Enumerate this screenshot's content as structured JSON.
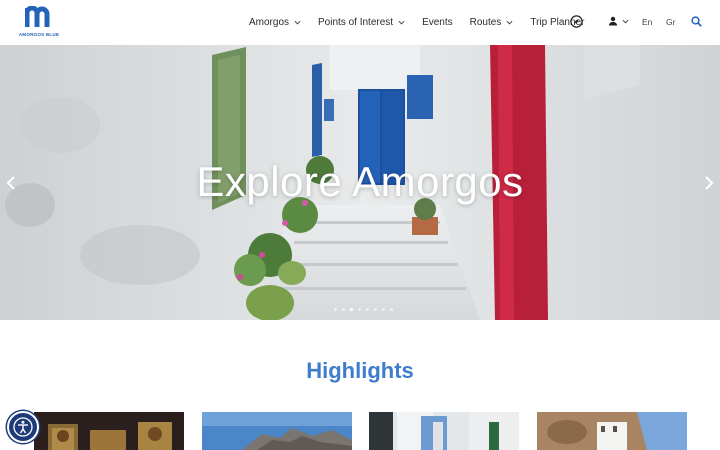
{
  "brand": {
    "name": "AMORGOS BLUE",
    "color": "#2563b8"
  },
  "nav": {
    "items": [
      {
        "label": "Amorgos",
        "has_dropdown": true
      },
      {
        "label": "Points of Interest",
        "has_dropdown": true
      },
      {
        "label": "Events",
        "has_dropdown": false
      },
      {
        "label": "Routes",
        "has_dropdown": true
      },
      {
        "label": "Trip Planner",
        "has_dropdown": false
      }
    ],
    "icons": [
      "compass-icon",
      "user-icon",
      "search-icon"
    ],
    "languages": [
      "En",
      "Gr"
    ]
  },
  "hero": {
    "title": "Explore Amorgos",
    "slide_count": 8,
    "active_slide": 2
  },
  "highlights": {
    "title": "Highlights",
    "title_color": "#3f7ccc",
    "cards": [
      {
        "icon": "icons-image"
      },
      {
        "icon": "coast-image"
      },
      {
        "icon": "village-image"
      },
      {
        "icon": "monastery-image"
      }
    ]
  },
  "accessibility": {
    "icon": "accessibility-icon"
  }
}
